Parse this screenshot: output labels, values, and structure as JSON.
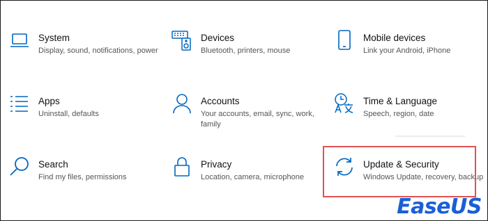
{
  "colors": {
    "icon": "#0067c0",
    "highlight": "#e05252",
    "brand": "#1b5fd6"
  },
  "tiles": [
    {
      "icon": "laptop-icon",
      "title": "System",
      "desc": "Display, sound, notifications, power"
    },
    {
      "icon": "keyboard-speaker-icon",
      "title": "Devices",
      "desc": "Bluetooth, printers, mouse"
    },
    {
      "icon": "phone-icon",
      "title": "Mobile devices",
      "desc": "Link your Android, iPhone"
    },
    {
      "icon": "apps-list-icon",
      "title": "Apps",
      "desc": "Uninstall, defaults"
    },
    {
      "icon": "person-icon",
      "title": "Accounts",
      "desc": "Your accounts, email, sync, work, family"
    },
    {
      "icon": "time-language-icon",
      "title": "Time & Language",
      "desc": "Speech, region, date"
    },
    {
      "icon": "search-icon",
      "title": "Search",
      "desc": "Find my files, permissions"
    },
    {
      "icon": "lock-icon",
      "title": "Privacy",
      "desc": "Location, camera, microphone"
    },
    {
      "icon": "sync-arrows-icon",
      "title": "Update & Security",
      "desc": "Windows Update, recovery, backup"
    }
  ],
  "watermark": {
    "text": "EaseUS"
  }
}
